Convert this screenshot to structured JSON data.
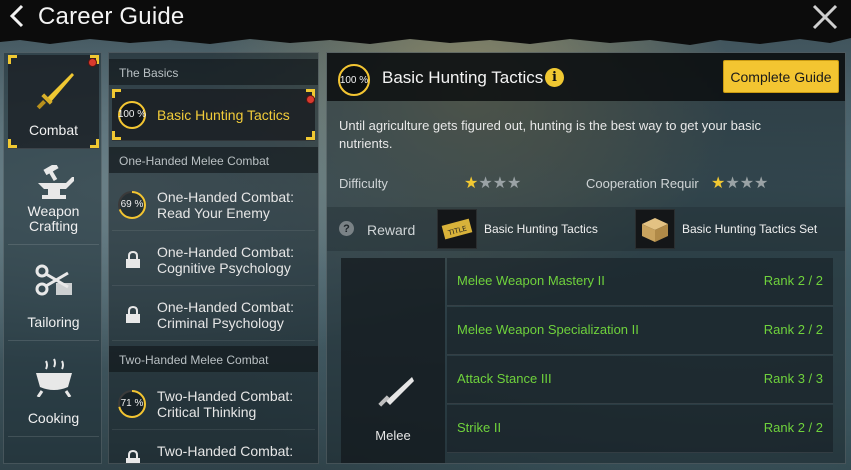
{
  "header": {
    "title": "Career Guide"
  },
  "categories": [
    {
      "label": "Combat",
      "icon": "dagger-icon",
      "active": true,
      "notify": true
    },
    {
      "label": "Weapon Crafting",
      "icon": "anvil-icon",
      "active": false
    },
    {
      "label": "Tailoring",
      "icon": "scissors-icon",
      "active": false
    },
    {
      "label": "Cooking",
      "icon": "cooking-pot-icon",
      "active": false
    }
  ],
  "guide_list": {
    "sections": [
      "The Basics",
      "One-Handed Melee Combat",
      "Two-Handed Melee Combat"
    ],
    "items": [
      {
        "label": "Basic Hunting Tactics",
        "progress": "100 %",
        "progress_value": 1.0,
        "active": true
      },
      {
        "label": "One-Handed Combat: Read Your Enemy",
        "progress": "69 %",
        "progress_value": 0.69
      },
      {
        "label": "One-Handed Combat: Cognitive Psychology",
        "locked": true
      },
      {
        "label": "One-Handed Combat: Criminal Psychology",
        "locked": true
      },
      {
        "label": "Two-Handed Combat: Critical Thinking",
        "progress": "71 %",
        "progress_value": 0.71
      },
      {
        "label": "Two-Handed Combat:",
        "locked": true
      }
    ]
  },
  "detail": {
    "progress": "100 %",
    "title": "Basic Hunting Tactics",
    "complete_button": "Complete Guide",
    "description": "Until agriculture gets figured out, hunting is the best way to get your basic nutrients.",
    "difficulty_label": "Difficulty",
    "difficulty_stars": 1,
    "cooperation_label": "Cooperation Requir",
    "cooperation_stars": 1,
    "max_stars": 4,
    "reward_label": "Reward",
    "rewards": [
      {
        "name": "Basic Hunting Tactics",
        "icon": "title-badge-icon"
      },
      {
        "name": "Basic Hunting Tactics Set",
        "icon": "crate-icon"
      }
    ],
    "skill_type": "Melee",
    "skills": [
      {
        "name": "Melee Weapon Mastery II",
        "rank": "Rank 2 / 2"
      },
      {
        "name": "Melee Weapon Specialization II",
        "rank": "Rank 2 / 2"
      },
      {
        "name": "Attack Stance III",
        "rank": "Rank 3 / 3"
      },
      {
        "name": "Strike II",
        "rank": "Rank 2 / 2"
      }
    ]
  },
  "colors": {
    "accent": "#f3c531",
    "skill_text": "#6fd23c",
    "notify": "#d93a2e"
  }
}
